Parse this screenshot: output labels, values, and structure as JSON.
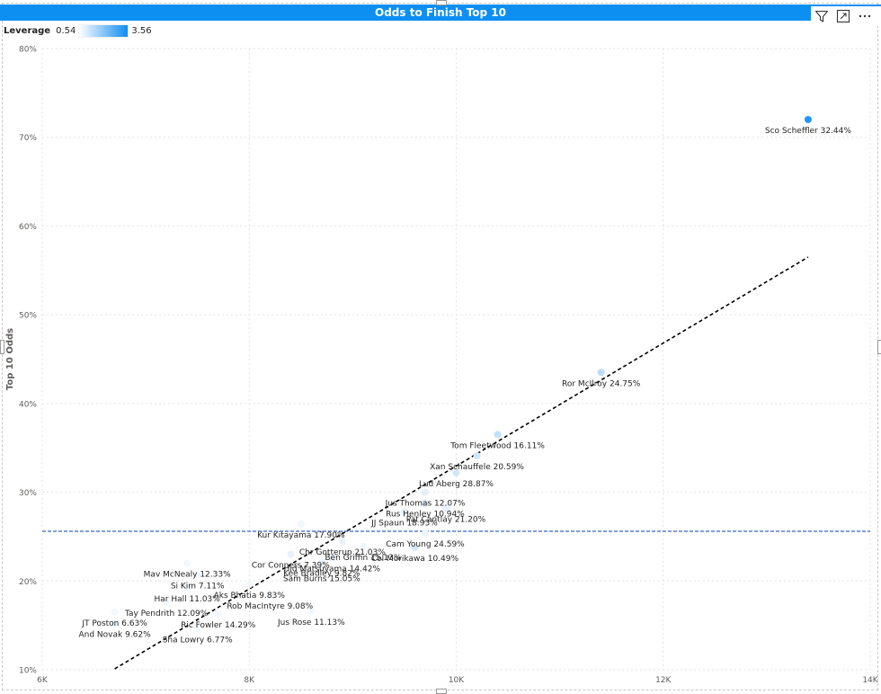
{
  "visual": {
    "title": "Odds to Finish Top 10"
  },
  "header_icons": [
    {
      "name": "filter-icon"
    },
    {
      "name": "focus-mode-icon"
    },
    {
      "name": "more-options-icon"
    }
  ],
  "legend": {
    "title": "Leverage",
    "min": "0.54",
    "max": "3.56",
    "color_low": "#ffffff",
    "color_high": "#118df0"
  },
  "chart_data": {
    "type": "scatter",
    "title": "Odds to Finish Top 10",
    "xlabel": "",
    "ylabel": "Top 10 Odds",
    "xlim": [
      6000,
      14000
    ],
    "ylim": [
      10,
      80
    ],
    "x_ticks": [
      {
        "v": 6000,
        "label": "6K"
      },
      {
        "v": 8000,
        "label": "8K"
      },
      {
        "v": 10000,
        "label": "10K"
      },
      {
        "v": 12000,
        "label": "12K"
      },
      {
        "v": 14000,
        "label": "14K"
      }
    ],
    "y_ticks": [
      {
        "v": 10,
        "label": "10%"
      },
      {
        "v": 20,
        "label": "20%"
      },
      {
        "v": 30,
        "label": "30%"
      },
      {
        "v": 40,
        "label": "40%"
      },
      {
        "v": 50,
        "label": "50%"
      },
      {
        "v": 60,
        "label": "60%"
      },
      {
        "v": 70,
        "label": "70%"
      },
      {
        "v": 80,
        "label": "80%"
      }
    ],
    "grid": true,
    "reference_line": {
      "y": 25.6,
      "color": "#5b7bd8"
    },
    "trend_line": {
      "x1": 6700,
      "y1": 10.1,
      "x2": 13400,
      "y2": 56.5,
      "color": "#000000"
    },
    "points": [
      {
        "label": "Sco Scheffler 32.44%",
        "x": 13400,
        "y": 72.0,
        "color": "#2196f3"
      },
      {
        "label": "Ror McIlroy 24.75%",
        "x": 11400,
        "y": 43.5,
        "color": "#bcdcf7"
      },
      {
        "label": "Tom Fleetwood 16.11%",
        "x": 10400,
        "y": 36.5,
        "color": "#c2e0f8"
      },
      {
        "label": "Xan Schauffele 20.59%",
        "x": 10200,
        "y": 34.1,
        "color": "#d0e7f9"
      },
      {
        "label": "Lud Aberg 28.87%",
        "x": 10000,
        "y": 32.2,
        "color": "#d0e7f9"
      },
      {
        "label": "Jus Thomas 12.07%",
        "x": 9700,
        "y": 30.0,
        "color": "#e2effb"
      },
      {
        "label": "Rus Henley 10.94%",
        "x": 9700,
        "y": 28.8,
        "color": "#dcecfb"
      },
      {
        "label": "Pat Cantlay 21.20%",
        "x": 9900,
        "y": 28.2,
        "color": "#e6f1fc"
      },
      {
        "label": "JJ Spaun 18.93%",
        "x": 9500,
        "y": 27.8,
        "color": "#e6f1fc"
      },
      {
        "label": "Cam Young 24.59%",
        "x": 9700,
        "y": 25.4,
        "color": "#edf5fd"
      },
      {
        "label": "Col Morikawa 10.49%",
        "x": 9600,
        "y": 23.8,
        "color": "#d6e9fa"
      },
      {
        "label": "Chr Gotterup 21.03%",
        "x": 8900,
        "y": 24.5,
        "color": "#eaf3fc"
      },
      {
        "label": "Kur Kitayama 17.90%",
        "x": 8500,
        "y": 26.4,
        "color": "#f0f6fd"
      },
      {
        "label": "Hid Matsuyama 14.42%",
        "x": 8800,
        "y": 22.6,
        "color": "#eaf3fc"
      },
      {
        "label": "Ben Griffin 15.13%",
        "x": 9100,
        "y": 23.9,
        "color": "#eef5fd"
      },
      {
        "label": "Kee Bradley 9.82%",
        "x": 8700,
        "y": 22.1,
        "color": "#e8f2fc"
      },
      {
        "label": "Cor Conners 7.39%",
        "x": 8400,
        "y": 23.0,
        "color": "#e9f2fc"
      },
      {
        "label": "Mav McNealy 12.33%",
        "x": 7400,
        "y": 22.0,
        "color": "#f3f8fe"
      },
      {
        "label": "Sam Burns 15.05%",
        "x": 8700,
        "y": 21.5,
        "color": "#f3f8fe"
      },
      {
        "label": "Si Kim 7.11%",
        "x": 7500,
        "y": 20.7,
        "color": "#f3f8fe"
      },
      {
        "label": "Aks Bhatia 9.83%",
        "x": 8000,
        "y": 19.6,
        "color": "#f3f8fe"
      },
      {
        "label": "Har Hall 11.03%",
        "x": 7400,
        "y": 19.2,
        "color": "#f3f8fe"
      },
      {
        "label": "Rob MacIntyre 9.08%",
        "x": 8200,
        "y": 18.4,
        "color": "#f3f8fe"
      },
      {
        "label": "Tay Pendrith 12.09%",
        "x": 7200,
        "y": 17.6,
        "color": "#f3f8fe"
      },
      {
        "label": "Ric Fowler 14.29%",
        "x": 7700,
        "y": 16.3,
        "color": "#f3f8fe"
      },
      {
        "label": "JT Poston 6.63%",
        "x": 6700,
        "y": 16.5,
        "color": "#f3f8fe"
      },
      {
        "label": "Jus Rose 11.13%",
        "x": 8600,
        "y": 16.6,
        "color": "#f3f8fe"
      },
      {
        "label": "Sha Lowry 6.77%",
        "x": 7500,
        "y": 14.6,
        "color": "#f3f8fe"
      },
      {
        "label": "And Novak 9.62%",
        "x": 6700,
        "y": 15.2,
        "color": "#eaf3fc"
      }
    ]
  }
}
